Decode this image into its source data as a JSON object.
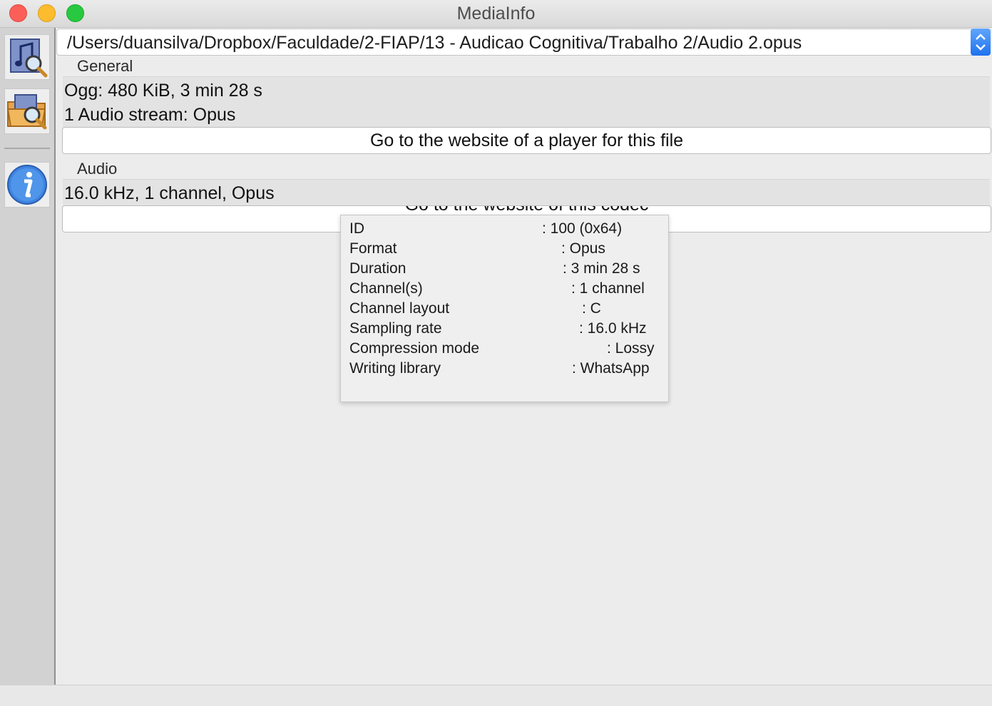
{
  "window": {
    "title": "MediaInfo"
  },
  "toolbar": {
    "open_file_icon": "open-media-file-icon",
    "open_folder_icon": "open-folder-icon",
    "about_icon": "info-icon"
  },
  "file_selector": {
    "path": "/Users/duansilva/Dropbox/Faculdade/2-FIAP/13 - Audicao Cognitiva/Trabalho 2/Audio 2.opus"
  },
  "general": {
    "label": "General",
    "lines": [
      "Ogg: 480 KiB, 3 min 28 s",
      "1 Audio stream: Opus"
    ],
    "player_button": "Go to the website of a player for this file"
  },
  "audio": {
    "label": "Audio",
    "lines": [
      "16.0 kHz, 1 channel, Opus"
    ],
    "codec_button": "Go to the website of this codec"
  },
  "tooltip": {
    "rows": [
      {
        "key": "ID",
        "value": ": 100 (0x64)"
      },
      {
        "key": "Format",
        "value": ": Opus"
      },
      {
        "key": "Duration",
        "value": ": 3 min 28 s"
      },
      {
        "key": "Channel(s)",
        "value": ": 1 channel"
      },
      {
        "key": "Channel layout",
        "value": ": C"
      },
      {
        "key": "Sampling rate",
        "value": ": 16.0 kHz"
      },
      {
        "key": "Compression mode",
        "value": ": Lossy"
      },
      {
        "key": "Writing library",
        "value": ": WhatsApp"
      }
    ]
  },
  "colors": {
    "close": "#fc5f57",
    "minimize": "#fdbc2e",
    "maximize": "#28c840",
    "combo_accent": "#2f7df6"
  }
}
